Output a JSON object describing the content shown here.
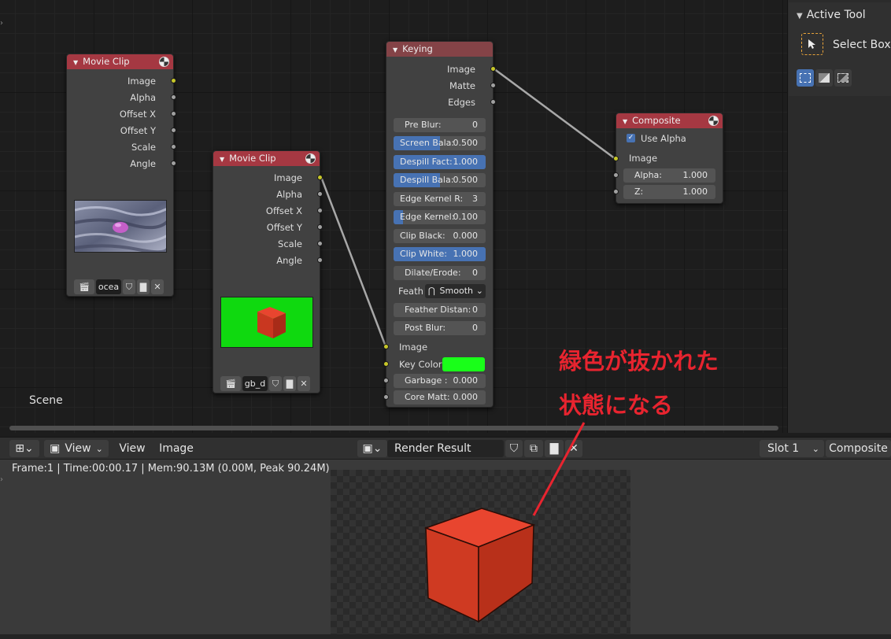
{
  "sidebar": {
    "title": "Active Tool",
    "tool_label": "Select Box",
    "mode_icons": [
      "select-box-new-icon",
      "select-box-extend-icon",
      "select-box-subtract-icon"
    ]
  },
  "editor": {
    "scene_label": "Scene"
  },
  "nodes": {
    "clip1": {
      "title": "Movie Clip",
      "outputs": [
        "Image",
        "Alpha",
        "Offset X",
        "Offset Y",
        "Scale",
        "Angle"
      ],
      "clip_name": "ocea"
    },
    "clip2": {
      "title": "Movie Clip",
      "outputs": [
        "Image",
        "Alpha",
        "Offset X",
        "Offset Y",
        "Scale",
        "Angle"
      ],
      "clip_name": "gb_d"
    },
    "keying": {
      "title": "Keying",
      "outputs": [
        "Image",
        "Matte",
        "Edges"
      ],
      "fields": [
        {
          "label": "Pre Blur:",
          "value": "0",
          "fill": 0
        },
        {
          "label": "Screen Bala:",
          "value": "0.500",
          "fill": 0.5
        },
        {
          "label": "Despill Fact:",
          "value": "1.000",
          "fill": 1
        },
        {
          "label": "Despill Bala:",
          "value": "0.500",
          "fill": 0.5
        },
        {
          "label": "Edge Kernel R:",
          "value": "3",
          "fill": 0
        },
        {
          "label": "Edge Kernel:",
          "value": "0.100",
          "fill": 0.1
        },
        {
          "label": "Clip Black:",
          "value": "0.000",
          "fill": 0
        },
        {
          "label": "Clip White:",
          "value": "1.000",
          "fill": 1
        },
        {
          "label": "Dilate/Erode:",
          "value": "0",
          "fill": 0
        }
      ],
      "feather_label": "Feath",
      "feather_value": "Smooth",
      "fields2": [
        {
          "label": "Feather Distan:",
          "value": "0"
        },
        {
          "label": "Post Blur:",
          "value": "0"
        }
      ],
      "input_image": "Image",
      "key_color_label": "Key Color",
      "key_color": "#19ff19",
      "garbage": {
        "label": "Garbage :",
        "value": "0.000"
      },
      "core": {
        "label": "Core Matt:",
        "value": "0.000"
      }
    },
    "composite": {
      "title": "Composite",
      "use_alpha": "Use Alpha",
      "image": "Image",
      "alpha": {
        "label": "Alpha:",
        "value": "1.000"
      },
      "z": {
        "label": "Z:",
        "value": "1.000"
      }
    }
  },
  "image_editor": {
    "header": {
      "view_menu": "View",
      "view_label": "View",
      "image_label": "Image",
      "image_name": "Render Result",
      "slot": "Slot 1",
      "layer": "Composite"
    },
    "frame_info": "Frame:1 | Time:00:00.17 | Mem:90.13M (0.00M, Peak 90.24M)"
  },
  "annotation": {
    "line1": "緑色が抜かれた",
    "line2": "状態になる",
    "color": "#e8242f"
  },
  "colors": {
    "node_header_red": "#a53842",
    "accent_blue": "#4772b3",
    "socket_yellow": "#c7c729",
    "socket_gray": "#a1a1a1"
  }
}
